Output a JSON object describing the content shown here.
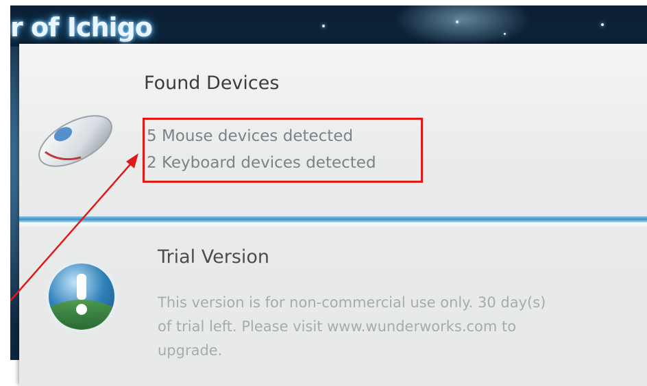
{
  "background": {
    "title": "r of Ichigo"
  },
  "found_devices": {
    "title": "Found Devices",
    "lines": [
      "5 Mouse devices detected",
      "2 Keyboard devices detected"
    ],
    "icon": "mouse-icon"
  },
  "trial": {
    "title": "Trial Version",
    "lines": [
      "This version is for non-commercial use only. 30 day(s)",
      "of trial left. Please visit www.wunderworks.com to",
      "upgrade."
    ],
    "icon": "info-icon"
  },
  "annotation": {
    "box_color": "#e01818",
    "arrow_color": "#e01818"
  }
}
